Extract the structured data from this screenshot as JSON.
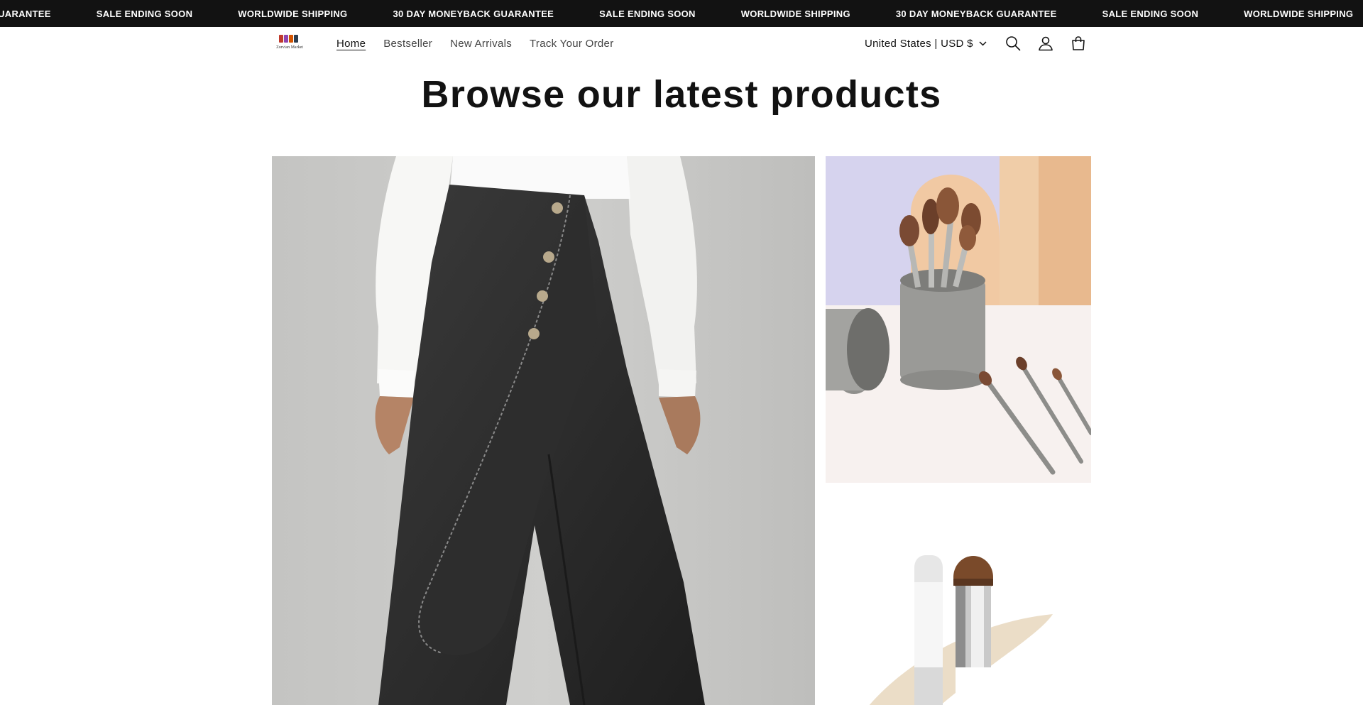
{
  "announcement": {
    "items": [
      "ONEYBACK GUARANTEE",
      "SALE ENDING SOON",
      "WORLDWIDE SHIPPING",
      "30 DAY MONEYBACK GUARANTEE",
      "SALE ENDING SOON",
      "WORLDWIDE SHIPPING",
      "30 DAY MONEYBACK GUARANTEE",
      "SALE ENDING SOON",
      "WORLDWIDE SHIPPING"
    ]
  },
  "header": {
    "logo_text": "Zorvian Market",
    "nav": [
      {
        "label": "Home",
        "active": true
      },
      {
        "label": "Bestseller",
        "active": false
      },
      {
        "label": "New Arrivals",
        "active": false
      },
      {
        "label": "Track Your Order",
        "active": false
      }
    ],
    "locale": "United States | USD $",
    "icons": [
      "search-icon",
      "account-icon",
      "cart-icon"
    ]
  },
  "main": {
    "heading": "Browse our latest products",
    "products": [
      {
        "name": "Black denim asymmetric wrap wide-leg pants"
      },
      {
        "name": "Makeup brush set with holder"
      },
      {
        "name": "Double-ended foundation stick with brush"
      }
    ]
  },
  "colors": {
    "ticker_bg": "#121212",
    "ticker_text": "#ffffff",
    "text": "#121212"
  }
}
